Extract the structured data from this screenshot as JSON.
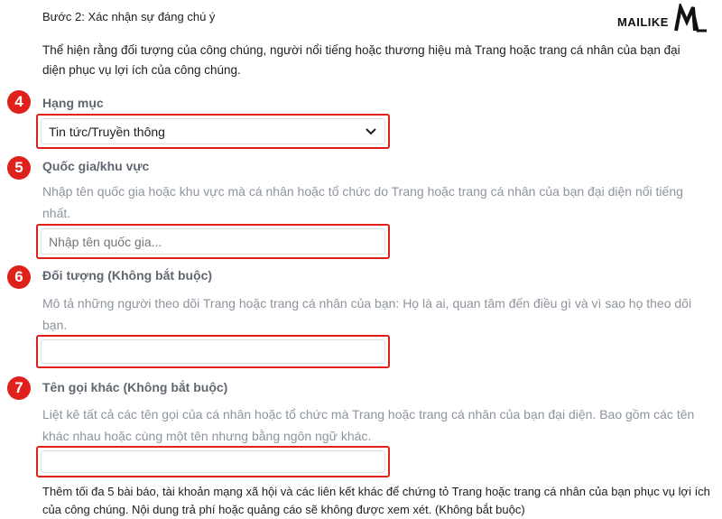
{
  "header": {
    "step_title": "Bước 2: Xác nhận sự đáng chú ý",
    "intro": "Thể hiện rằng đối tượng của công chúng, người nổi tiếng hoặc thương hiệu mà Trang hoặc trang cá nhân của bạn đại diện phục vụ lợi ích của công chúng.",
    "logo_text": "MAILIKE"
  },
  "sections": [
    {
      "number": "4",
      "label": "Hạng mục",
      "select_value": "Tin tức/Truyền thông"
    },
    {
      "number": "5",
      "label": "Quốc gia/khu vực",
      "description": "Nhập tên quốc gia hoặc khu vực mà cá nhân hoặc tổ chức do Trang hoặc trang cá nhân của bạn đại diện nổi tiếng nhất.",
      "placeholder": "Nhập tên quốc gia..."
    },
    {
      "number": "6",
      "label": "Đối tượng (Không bắt buộc)",
      "description": "Mô tả những người theo dõi Trang hoặc trang cá nhân của bạn: Họ là ai, quan tâm đến điều gì và vì sao họ theo dõi bạn.",
      "value": ""
    },
    {
      "number": "7",
      "label": "Tên gọi khác (Không bắt buộc)",
      "description": "Liệt kê tất cả các tên gọi của cá nhân hoặc tổ chức mà Trang hoặc trang cá nhân của bạn đại diện. Bao gồm các tên khác nhau hoặc cùng một tên nhưng bằng ngôn ngữ khác.",
      "value": ""
    }
  ],
  "footer": {
    "text": "Thêm tối đa 5 bài báo, tài khoản mạng xã hội và các liên kết khác để chứng tỏ Trang hoặc trang cá nhân của bạn phục vụ lợi ích của công chúng. Nội dung trả phí hoặc quảng cáo sẽ không được xem xét. (Không bắt buộc)"
  },
  "colors": {
    "annotation_red": "#e0201b",
    "label_gray": "#606770",
    "description_gray": "#8d949e"
  }
}
